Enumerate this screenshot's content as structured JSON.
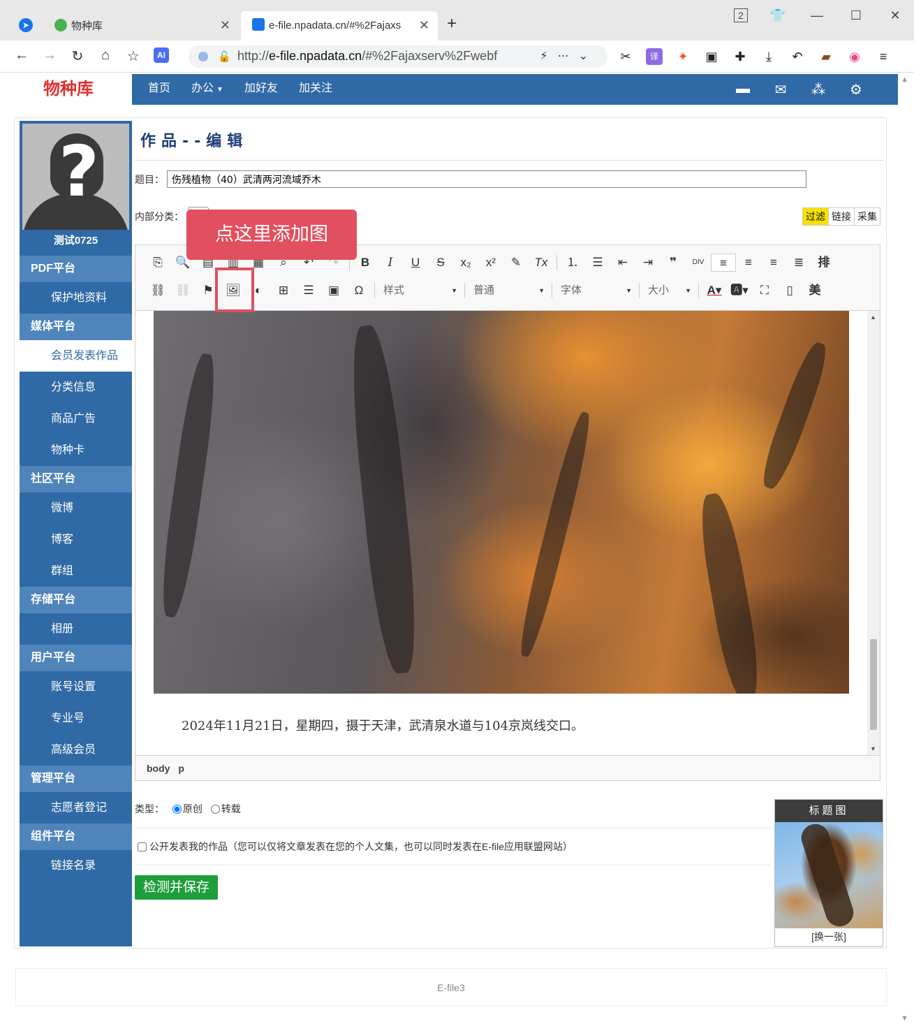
{
  "browser": {
    "tabs": [
      {
        "title": "物种库"
      },
      {
        "title": "e-file.npadata.cn/#%2Fajaxs"
      }
    ],
    "tab_badge": "2",
    "url_prefix": "http://",
    "url_host": "e-file.npadata.cn",
    "url_rest": "/#%2Fajaxserv%2Fwebf",
    "ai_label": "AI"
  },
  "site": {
    "brand": "物种库",
    "nav": [
      "首页",
      "办公",
      "加好友",
      "加关注"
    ]
  },
  "sidebar": {
    "username": "测试0725",
    "items": [
      {
        "label": "PDF平台",
        "kind": "group"
      },
      {
        "label": "保护地资料",
        "kind": "sub"
      },
      {
        "label": "媒体平台",
        "kind": "group"
      },
      {
        "label": "会员发表作品",
        "kind": "active"
      },
      {
        "label": "分类信息",
        "kind": "sub"
      },
      {
        "label": "商品广告",
        "kind": "sub"
      },
      {
        "label": "物种卡",
        "kind": "sub"
      },
      {
        "label": "社区平台",
        "kind": "group"
      },
      {
        "label": "微博",
        "kind": "sub"
      },
      {
        "label": "博客",
        "kind": "sub"
      },
      {
        "label": "群组",
        "kind": "sub"
      },
      {
        "label": "存储平台",
        "kind": "group"
      },
      {
        "label": "相册",
        "kind": "sub"
      },
      {
        "label": "用户平台",
        "kind": "group"
      },
      {
        "label": "账号设置",
        "kind": "sub"
      },
      {
        "label": "专业号",
        "kind": "sub"
      },
      {
        "label": "高级会员",
        "kind": "sub"
      },
      {
        "label": "管理平台",
        "kind": "group"
      },
      {
        "label": "志愿者登记",
        "kind": "sub"
      },
      {
        "label": "组件平台",
        "kind": "group"
      },
      {
        "label": "链接名录",
        "kind": "sub"
      }
    ]
  },
  "form": {
    "page_title": "作品--编辑",
    "subject_label": "题目：",
    "subject_value": "伤残植物（40）武清两河流域乔木",
    "category_label": "内部分类：",
    "mode_buttons": [
      "过滤",
      "链接",
      "采集"
    ],
    "tooltip": "点这里添加图",
    "editor": {
      "combos": {
        "style": "样式",
        "format": "普通",
        "font": "字体",
        "size": "大小"
      },
      "caption": "2024年11月21日，星期四，摄于天津，武清泉水道与104京岚线交口。",
      "status_path": "body p"
    },
    "type_label": "类型：",
    "type_options": [
      "原创",
      "转载"
    ],
    "type_selected": "原创",
    "public_label": "公开发表我的作品（您可以仅将文章发表在您的个人文集，也可以同时发表在E-file应用联盟网站）",
    "save_button": "检测并保存",
    "thumbnail": {
      "title": "标题图",
      "change": "[换一张]"
    }
  },
  "footer": {
    "text": "E-file3"
  }
}
